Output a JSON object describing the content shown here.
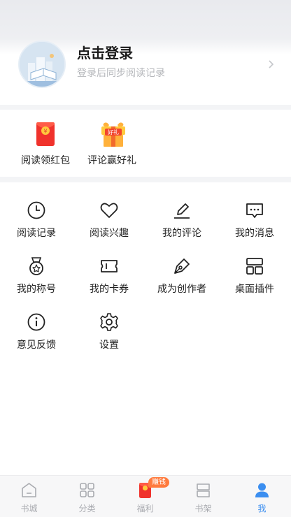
{
  "profile": {
    "title": "点击登录",
    "subtitle": "登录后同步阅读记录"
  },
  "rewards": [
    {
      "label": "阅读领红包",
      "icon": "red-packet-icon"
    },
    {
      "label": "评论赢好礼",
      "icon": "gift-box-icon",
      "tag": "好礼"
    }
  ],
  "grid": [
    {
      "label": "阅读记录",
      "icon": "clock-icon"
    },
    {
      "label": "阅读兴趣",
      "icon": "heart-icon"
    },
    {
      "label": "我的评论",
      "icon": "edit-icon"
    },
    {
      "label": "我的消息",
      "icon": "message-icon"
    },
    {
      "label": "我的称号",
      "icon": "medal-icon"
    },
    {
      "label": "我的卡券",
      "icon": "coupon-icon"
    },
    {
      "label": "成为创作者",
      "icon": "pen-nib-icon"
    },
    {
      "label": "桌面插件",
      "icon": "widget-icon"
    },
    {
      "label": "意见反馈",
      "icon": "info-icon"
    },
    {
      "label": "设置",
      "icon": "gear-icon"
    }
  ],
  "tabs": [
    {
      "label": "书城",
      "icon": "home-icon"
    },
    {
      "label": "分类",
      "icon": "grid-icon"
    },
    {
      "label": "福利",
      "icon": "red-packet-icon",
      "badge": "赚钱"
    },
    {
      "label": "书架",
      "icon": "bookshelf-icon"
    },
    {
      "label": "我",
      "icon": "user-icon",
      "active": true
    }
  ],
  "colors": {
    "accent": "#3b8ef0",
    "red": "#f23b2f",
    "badge": "#ff7a3d"
  }
}
